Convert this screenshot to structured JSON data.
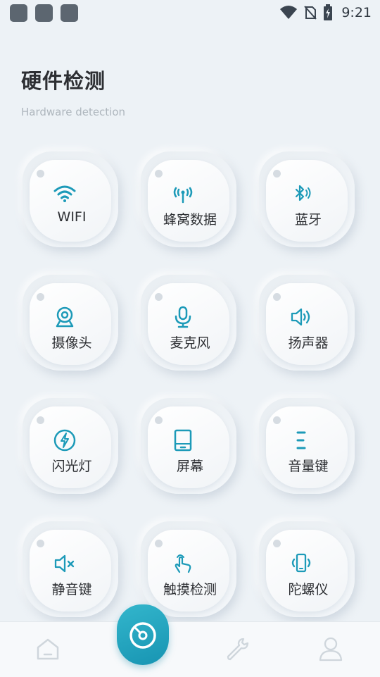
{
  "status_bar": {
    "time": "9:21",
    "icons": [
      "app-icon-1",
      "app-icon-2",
      "app-icon-3",
      "wifi-icon",
      "no-sim-icon",
      "battery-charging-icon"
    ]
  },
  "page": {
    "title": "硬件检测",
    "subtitle": "Hardware detection"
  },
  "accent_color": "#1c9ab8",
  "tiles": [
    {
      "label": "WIFI",
      "icon": "wifi-icon"
    },
    {
      "label": "蜂窝数据",
      "icon": "cellular-antenna-icon"
    },
    {
      "label": "蓝牙",
      "icon": "bluetooth-icon"
    },
    {
      "label": "摄像头",
      "icon": "webcam-icon"
    },
    {
      "label": "麦克风",
      "icon": "microphone-icon"
    },
    {
      "label": "扬声器",
      "icon": "speaker-icon"
    },
    {
      "label": "闪光灯",
      "icon": "flash-icon"
    },
    {
      "label": "屏幕",
      "icon": "screen-icon"
    },
    {
      "label": "音量键",
      "icon": "volume-keys-icon"
    },
    {
      "label": "静音键",
      "icon": "mute-icon"
    },
    {
      "label": "触摸检测",
      "icon": "touch-icon"
    },
    {
      "label": "陀螺仪",
      "icon": "gyroscope-icon"
    }
  ],
  "bottom_nav": {
    "items": [
      "home-icon",
      "dashboard-gauge-icon",
      "wrench-icon",
      "profile-icon"
    ],
    "active": "dashboard-gauge-icon"
  }
}
